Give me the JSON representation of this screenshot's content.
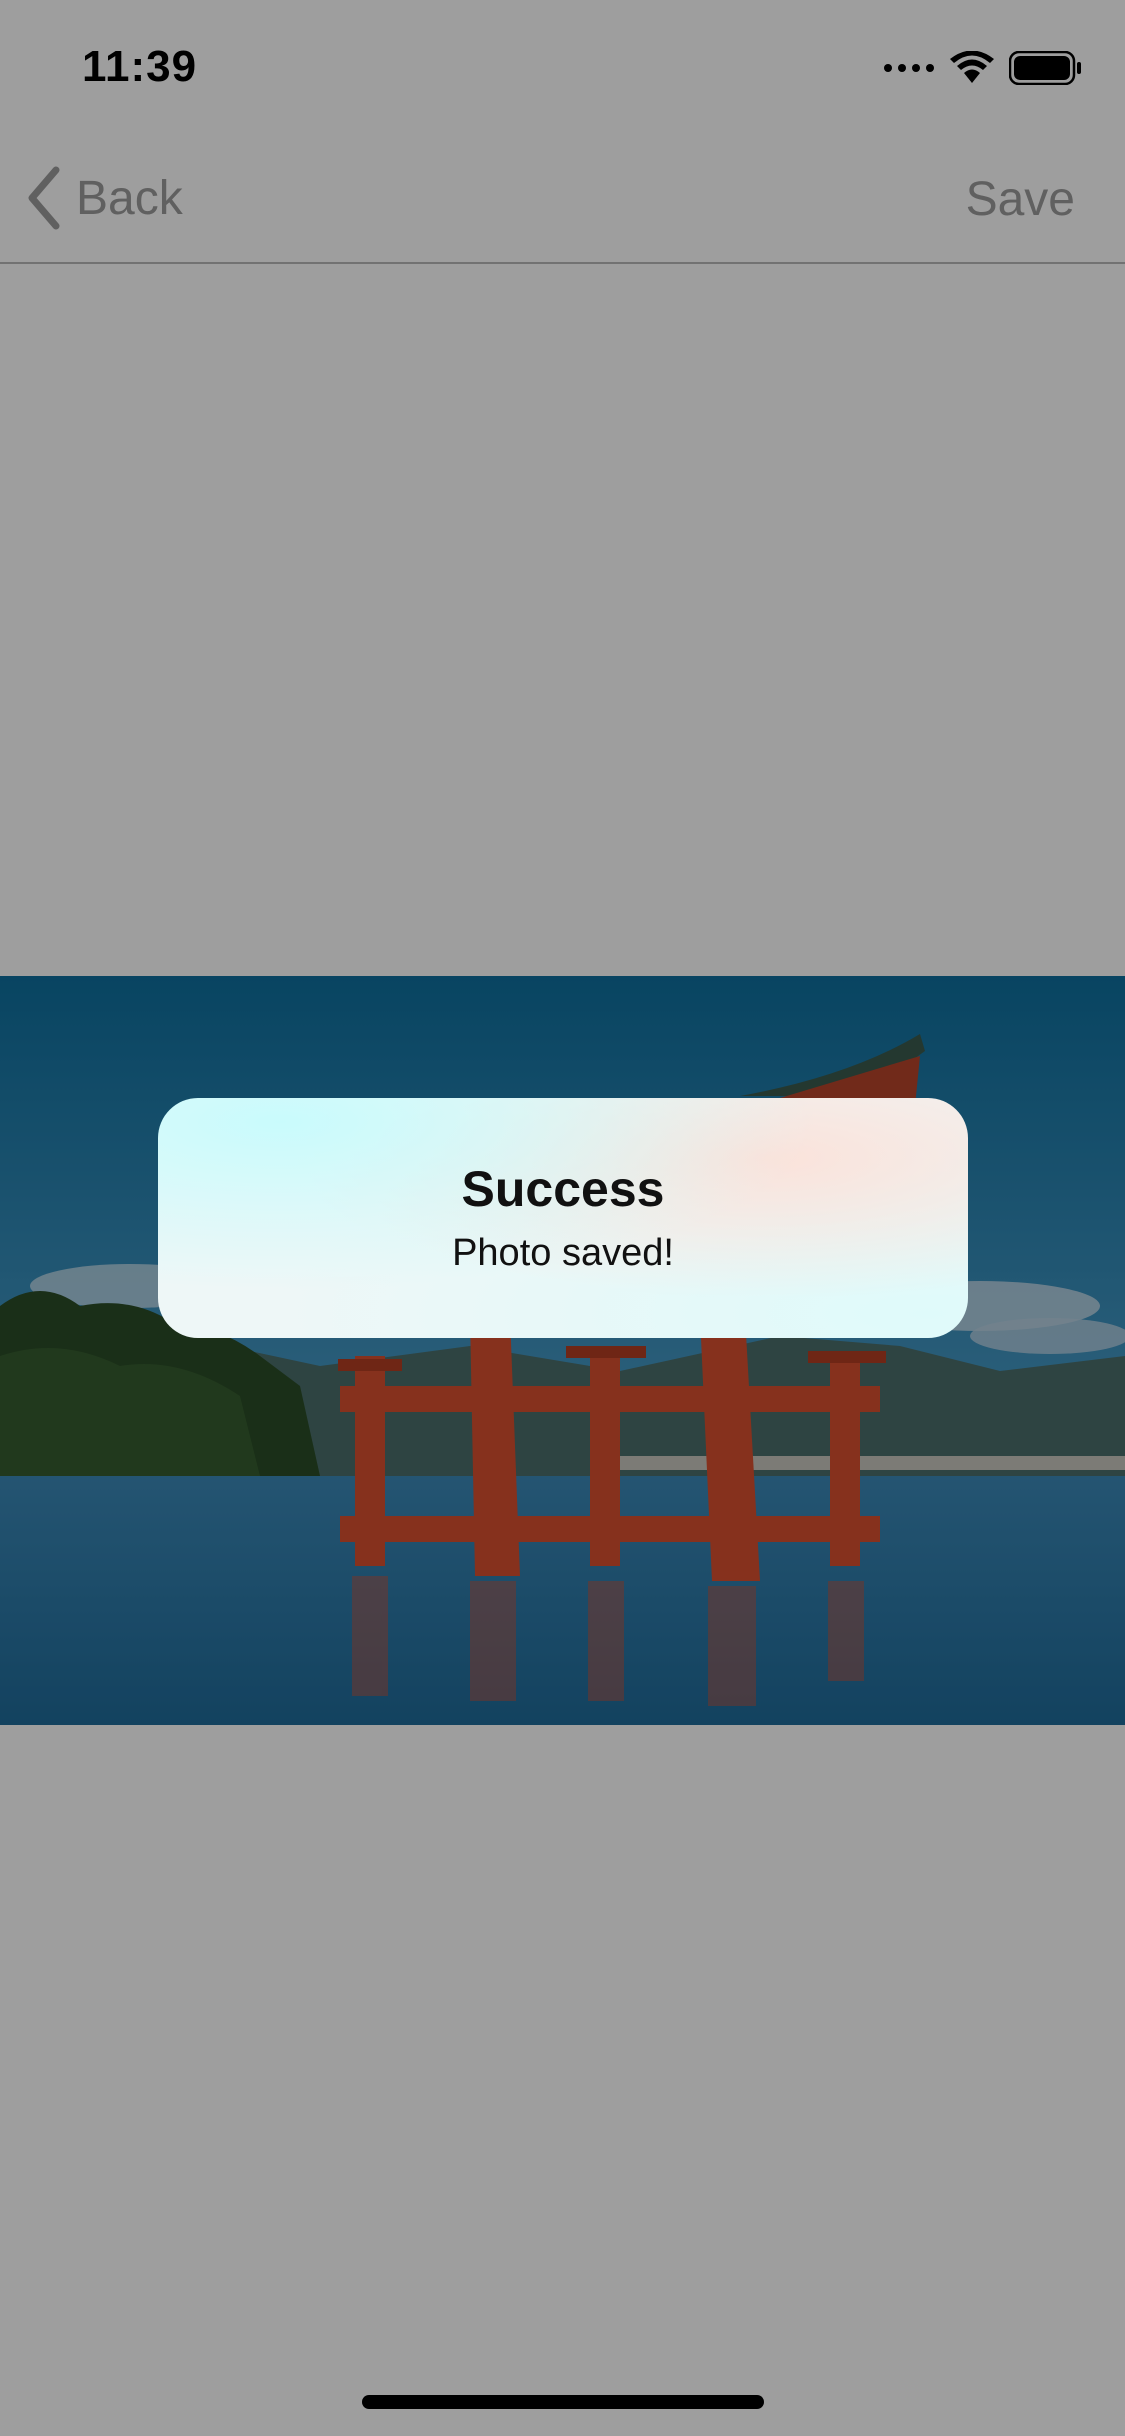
{
  "status_bar": {
    "time": "11:39",
    "icons": [
      "signal-dots-icon",
      "wifi-icon",
      "battery-icon"
    ]
  },
  "nav_bar": {
    "back_label": "Back",
    "save_label": "Save"
  },
  "photo": {
    "icon": "photo-torii-gate"
  },
  "alert": {
    "title": "Success",
    "message": "Photo saved!"
  },
  "colors": {
    "nav_text": "#9b9b9b",
    "overlay": "rgba(0,0,0,0.38)",
    "alert_text": "#111111"
  }
}
